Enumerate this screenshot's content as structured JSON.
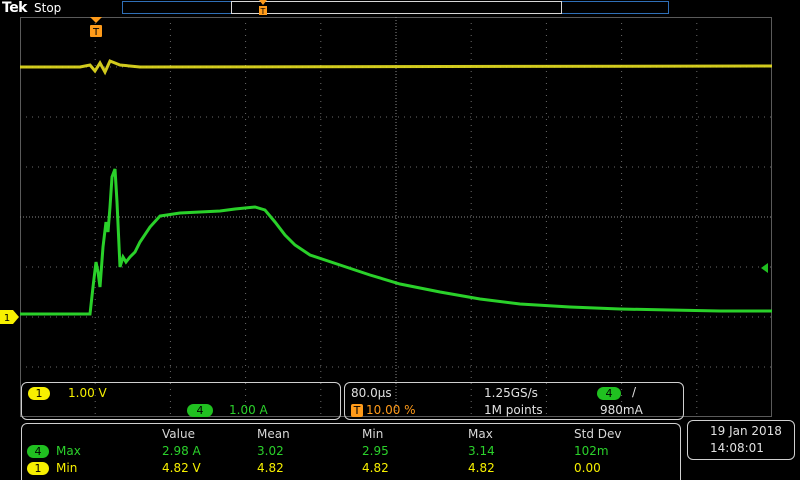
{
  "header": {
    "brand": "Tek",
    "run_state": "Stop"
  },
  "trigger_marker": "T",
  "channel_marker": "1",
  "channels": {
    "ch1": {
      "label": "1",
      "scale": "1.00 V",
      "color": "#f7f000"
    },
    "ch4": {
      "label": "4",
      "scale": "1.00 A",
      "color": "#20c020"
    }
  },
  "timebase": {
    "horizontal": "80.0µs",
    "sample_rate": "1.25GS/s",
    "record_length": "1M points",
    "trigger_position": "10.00 %",
    "trigger_source": "4",
    "trigger_slope": "/",
    "trigger_level": "980mA",
    "trigger_icon": "T"
  },
  "measurements": {
    "columns": [
      "Value",
      "Mean",
      "Min",
      "Max",
      "Std Dev"
    ],
    "rows": [
      {
        "channel": "4",
        "name": "Max",
        "values": [
          "2.98 A",
          "3.02",
          "2.95",
          "3.14",
          "102m"
        ]
      },
      {
        "channel": "1",
        "name": "Min",
        "values": [
          "4.82 V",
          "4.82",
          "4.82",
          "4.82",
          "0.00"
        ]
      }
    ]
  },
  "datetime": {
    "date": "19 Jan  2018",
    "time": "14:08:01"
  },
  "colors": {
    "ch1": "#f7f000",
    "ch4": "#20c020",
    "trigger": "#ff9b1a",
    "grid": "#5a5a5a"
  }
}
